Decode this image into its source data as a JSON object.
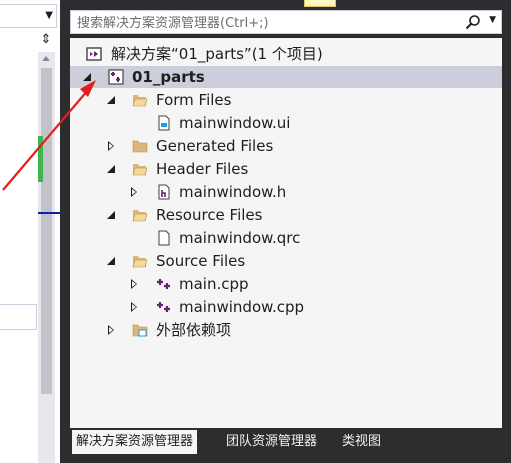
{
  "search": {
    "placeholder": "搜索解决方案资源管理器(Ctrl+;)"
  },
  "tree": {
    "solution": "解决方案“01_parts”(1 个项目)",
    "project": "01_parts",
    "form_files": "Form Files",
    "mainwindow_ui": "mainwindow.ui",
    "generated_files": "Generated Files",
    "header_files": "Header Files",
    "mainwindow_h": "mainwindow.h",
    "resource_files": "Resource Files",
    "mainwindow_qrc": "mainwindow.qrc",
    "source_files": "Source Files",
    "main_cpp": "main.cpp",
    "mainwindow_cpp": "mainwindow.cpp",
    "external_deps": "外部依赖项"
  },
  "tabs": [
    "解决方案资源管理器",
    "团队资源管理器",
    "类视图"
  ],
  "colors": {
    "annotation_arrow": "#e02020",
    "selection": "#cccedb",
    "folder": "#dcb67a"
  }
}
